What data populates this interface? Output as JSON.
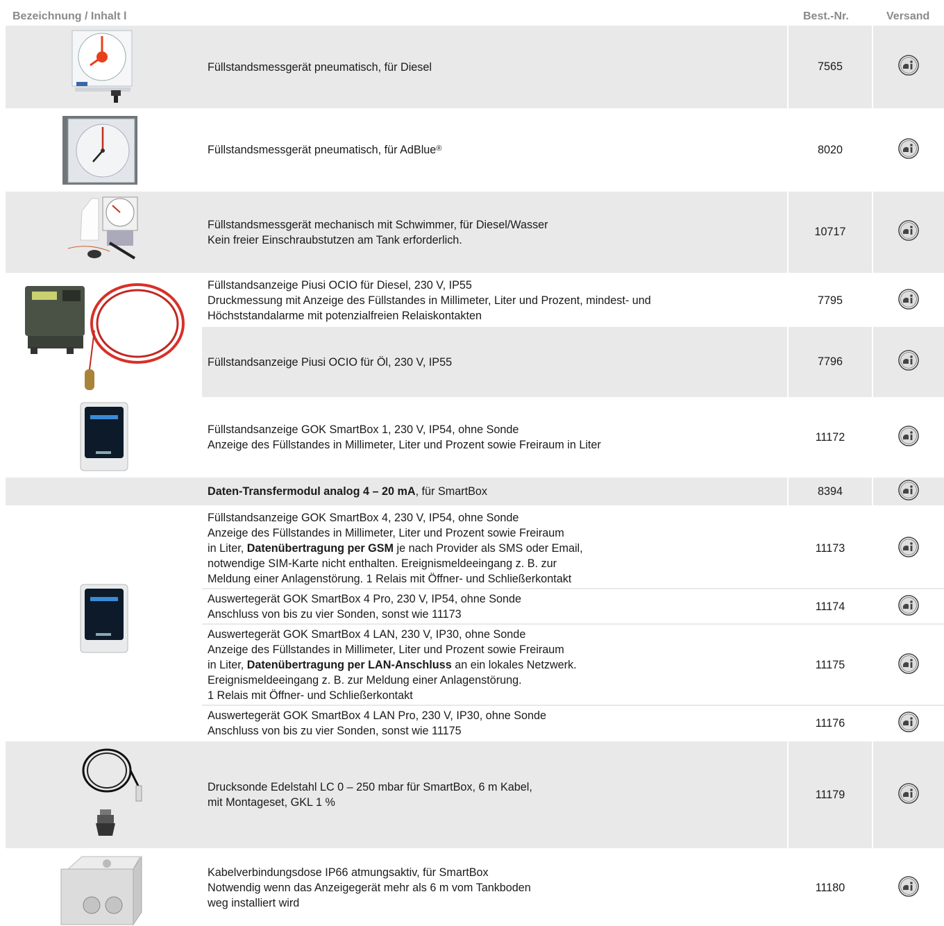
{
  "header": {
    "col_description": "Bezeichnung / Inhalt l",
    "col_order_no": "Best.-Nr.",
    "col_shipping": "Versand"
  },
  "shipping_icon": "shipping-info-icon",
  "rows": [
    {
      "lines": [
        "Füllstandsmessgerät pneumatisch, für Diesel"
      ],
      "order_no": "7565"
    },
    {
      "lines": [
        "Füllstandsmessgerät pneumatisch, für AdBlue"
      ],
      "sup": "®",
      "order_no": "8020"
    },
    {
      "lines": [
        "Füllstandsmessgerät mechanisch mit Schwimmer, für Diesel/Wasser",
        "Kein freier Einschraubstutzen am Tank erforderlich."
      ],
      "order_no": "10717"
    },
    {
      "lines": [
        "Füllstandsanzeige Piusi OCIO für Diesel, 230 V, IP55",
        "Druckmessung mit Anzeige des Füllstandes in Millimeter, Liter und Prozent, mindest- und",
        "Höchststandalarme mit potenzialfreien Relaiskontakten"
      ],
      "order_no": "7795"
    },
    {
      "lines": [
        "Füllstandsanzeige Piusi OCIO für Öl, 230 V, IP55"
      ],
      "order_no": "7796"
    },
    {
      "lines": [
        "Füllstandsanzeige GOK SmartBox 1, 230 V, IP54, ohne Sonde",
        "Anzeige des Füllstandes in Millimeter, Liter und Prozent sowie Freiraum in Liter"
      ],
      "order_no": "11172"
    },
    {
      "bold": "Daten-Transfermodul analog 4 – 20 mA",
      "rest": ", für SmartBox",
      "order_no": "8394"
    },
    {
      "lines": [
        "Füllstandsanzeige GOK SmartBox 4, 230 V, IP54, ohne Sonde",
        "Anzeige des Füllstandes in Millimeter, Liter und Prozent sowie Freiraum"
      ],
      "l3_pre": "in Liter, ",
      "l3_bold": "Datenübertragung per GSM",
      "l3_post": " je nach Provider als SMS oder Email,",
      "lines_after": [
        "notwendige SIM-Karte nicht enthalten. Ereignismeldeeingang z. B. zur",
        "Meldung einer Anlagenstörung. 1 Relais mit Öffner- und Schließerkontakt"
      ],
      "order_no": "11173"
    },
    {
      "lines": [
        "Auswertegerät GOK SmartBox 4 Pro, 230 V, IP54, ohne Sonde",
        "Anschluss von bis zu vier Sonden, sonst wie 11173"
      ],
      "order_no": "11174"
    },
    {
      "lines": [
        "Auswertegerät GOK SmartBox 4 LAN, 230 V, IP30, ohne Sonde",
        "Anzeige des Füllstandes in Millimeter, Liter und Prozent sowie Freiraum"
      ],
      "l3_pre": "in Liter, ",
      "l3_bold": "Datenübertragung per LAN-Anschluss",
      "l3_post": " an ein lokales Netzwerk.",
      "lines_after": [
        "Ereignismeldeeingang z. B. zur Meldung einer Anlagenstörung.",
        "1 Relais mit Öffner- und Schließerkontakt"
      ],
      "order_no": "11175"
    },
    {
      "lines": [
        "Auswertegerät GOK SmartBox 4 LAN Pro, 230 V, IP30, ohne Sonde",
        "Anschluss von bis zu vier Sonden, sonst wie 11175"
      ],
      "order_no": "11176"
    },
    {
      "lines": [
        "Drucksonde Edelstahl LC 0 – 250 mbar für SmartBox, 6 m Kabel,",
        "mit Montageset, GKL 1 %"
      ],
      "order_no": "11179"
    },
    {
      "lines": [
        "Kabelverbindungsdose IP66 atmungsaktiv, für SmartBox",
        "Notwendig wenn das Anzeigegerät mehr als 6 m vom Tankboden",
        "weg installiert wird"
      ],
      "order_no": "11180"
    }
  ]
}
